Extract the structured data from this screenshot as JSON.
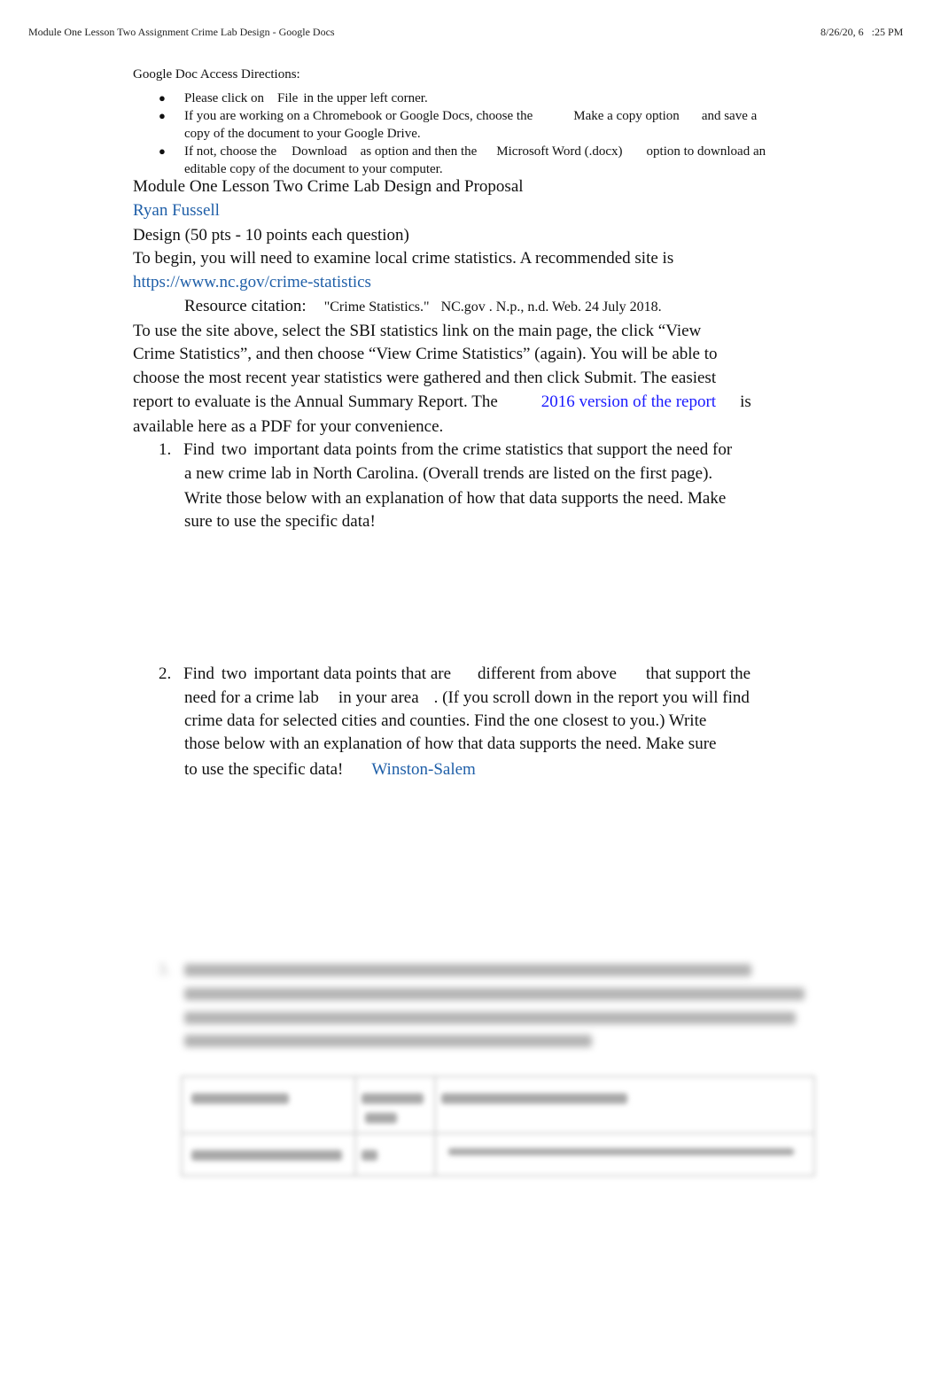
{
  "print_header": {
    "title": "Module One Lesson Two Assignment Crime Lab Design - Google Docs",
    "timestamp": "8/26/20, 6   :25 PM"
  },
  "access_directions": {
    "heading": "Google Doc Access Directions:",
    "bullet_1": {
      "pre": "Please click on",
      "file": "File",
      "post": "in the upper left corner."
    },
    "bullet_2": {
      "pre": "If you are working on a Chromebook or Google Docs, choose the",
      "option": "Make a copy option",
      "post": "and save a",
      "line2": "copy of the document to your Google Drive."
    },
    "bullet_3": {
      "pre": "If not, choose the",
      "download": "Download",
      "mid": "as option and then the",
      "word": "Microsoft Word (.docx)",
      "post": "option to download an",
      "line2": "editable copy of the document to your computer."
    }
  },
  "document": {
    "title": "Module One Lesson Two Crime Lab Design and Proposal",
    "student_name": "Ryan Fussell",
    "section_heading": "Design (50 pts - 10 points each question)",
    "intro": "To begin, you will need to examine local crime statistics. A recommended site is",
    "site_link": "https://www.nc.gov/crime-statistics",
    "citation_label": "Resource citation:",
    "citation_title": "\"Crime Statistics.\"",
    "citation_rest": "NC.gov . N.p., n.d. Web. 24 July 2018.",
    "instructions": [
      "To use the site above, select the SBI statistics link on the main page, the click “View",
      "Crime Statistics”, and then choose “View Crime Statistics” (again). You will be able to",
      "choose the most recent year statistics were gathered and then click Submit. The easiest"
    ],
    "instructions_line4_pre": "report to evaluate is the Annual Summary Report. The",
    "report_link": "2016 version of the report",
    "instructions_line4_post": "is",
    "instructions_line5": "available here as a PDF for your convenience."
  },
  "questions": {
    "q1": {
      "number": "1.",
      "line1_find": "Find",
      "line1_two": "two",
      "line1_rest": "important data points from the crime statistics that support the need for",
      "line2": "a new crime lab in North Carolina. (Overall trends are listed on the first page).",
      "line3": "Write those below with an explanation of how that data supports the need. Make",
      "line4": "sure to use the specific data!"
    },
    "q2": {
      "number": "2.",
      "line1_find": "Find",
      "line1_two": "two",
      "line1_a": "important data points that are",
      "line1_b": "different from above",
      "line1_c": "that support the",
      "line2_a": "need for a crime lab",
      "line2_b": "in your area",
      "line2_c": ". (If you scroll down in the report you will find",
      "line3": "crime data for selected cities and counties. Find the one closest to you.) Write",
      "line4": "those below with an explanation of how that data supports the need. Make sure",
      "line5": "to use the specific data!",
      "answer": "Winston-Salem"
    },
    "q3_blurred_number": "3."
  },
  "colors": {
    "student_blue": "#1f5fa8",
    "link_blue": "#1a1aff"
  }
}
